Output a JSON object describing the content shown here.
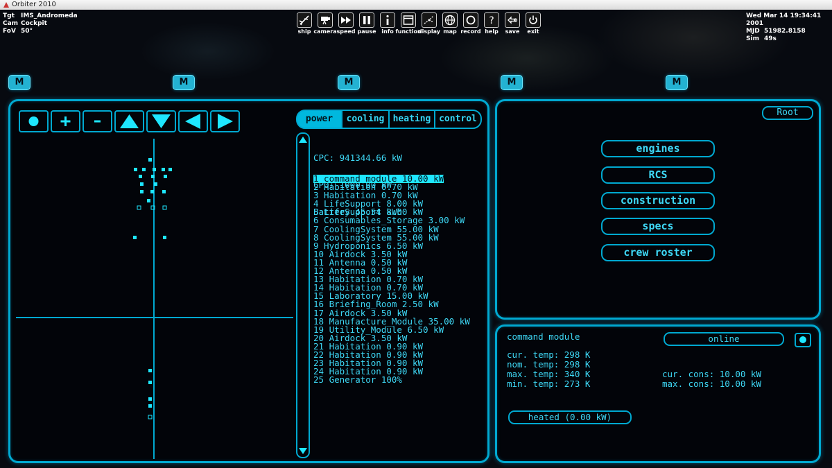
{
  "window": {
    "title": "Orbiter 2010"
  },
  "hud_left": {
    "tgt_label": "Tgt",
    "tgt_value": "IMS_Andromeda",
    "cam_label": "Cam",
    "cam_value": "Cockpit",
    "fov_label": "FoV",
    "fov_value": "50°"
  },
  "hud_right": {
    "date": "Wed Mar 14 19:34:41 2001",
    "mjd_label": "MJD",
    "mjd_value": "51982.8158",
    "sim_label": "Sim",
    "sim_value": "49s"
  },
  "toolbar": [
    {
      "label": "ship",
      "icon": "ship-icon"
    },
    {
      "label": "camera",
      "icon": "camera-icon"
    },
    {
      "label": "speed",
      "icon": "fast-forward-icon"
    },
    {
      "label": "pause",
      "icon": "pause-icon"
    },
    {
      "label": "info",
      "icon": "info-icon"
    },
    {
      "label": "function",
      "icon": "window-icon"
    },
    {
      "label": "display",
      "icon": "display-icon"
    },
    {
      "label": "map",
      "icon": "globe-icon"
    },
    {
      "label": "record",
      "icon": "record-icon"
    },
    {
      "label": "help",
      "icon": "help-icon"
    },
    {
      "label": "save",
      "icon": "save-icon"
    },
    {
      "label": "exit",
      "icon": "power-icon"
    }
  ],
  "mfd_tabs": [
    "M",
    "M",
    "M",
    "M",
    "M"
  ],
  "left_panel": {
    "controls": [
      "record-dot",
      "zoom-in",
      "zoom-out",
      "up",
      "down",
      "left",
      "right"
    ],
    "tabs": [
      "power",
      "cooling",
      "heating",
      "control"
    ],
    "active_tab": "power",
    "cpc": "CPC: 941344.66 kW",
    "cp0": "CP0: 1000.00 kW",
    "battery": "Battery 45.54 kWh",
    "modules": [
      "1 command module 10.00 kW",
      "2 Habitation 0.70 kW",
      "3 Habitation 0.70 kW",
      "4 LifeSupport 8.00 kW",
      "5 LifeSupport 8.00 kW",
      "6 Consumables_Storage 3.00 kW",
      "7 CoolingSystem 55.00 kW",
      "8 CoolingSystem 55.00 kW",
      "9 Hydroponics 6.50 kW",
      "10 Airdock 3.50 kW",
      "11 Antenna 0.50 kW",
      "12 Antenna 0.50 kW",
      "13 Habitation 0.70 kW",
      "14 Habitation 0.70 kW",
      "15 Laboratory 15.00 kW",
      "16 Briefing_Room 2.50 kW",
      "17 Airdock 3.50 kW",
      "18 Manufacture_Module 35.00 kW",
      "19 Utility_Module 6.50 kW",
      "20 Airdock 3.50 kW",
      "21 Habitation 0.90 kW",
      "22 Habitation 0.90 kW",
      "23 Habitation 0.90 kW",
      "24 Habitation 0.90 kW",
      "25 Generator 100%"
    ],
    "selected_index": 0
  },
  "nav_panel": {
    "root": "Root",
    "buttons": [
      "engines",
      "RCS",
      "construction",
      "specs",
      "crew roster"
    ]
  },
  "detail_panel": {
    "title": "command module",
    "status": "online",
    "cur_temp": "cur. temp: 298 K",
    "nom_temp": "nom. temp: 298 K",
    "max_temp": "max. temp: 340 K",
    "min_temp": "min. temp: 273 K",
    "cur_cons": "cur. cons: 10.00 kW",
    "max_cons": "max. cons: 10.00 kW",
    "heated": "heated (0.00 kW)"
  },
  "colors": {
    "accent": "#00a9d1",
    "text": "#3ed8f6",
    "highlight": "#1ee6ff",
    "background": "#020409"
  }
}
